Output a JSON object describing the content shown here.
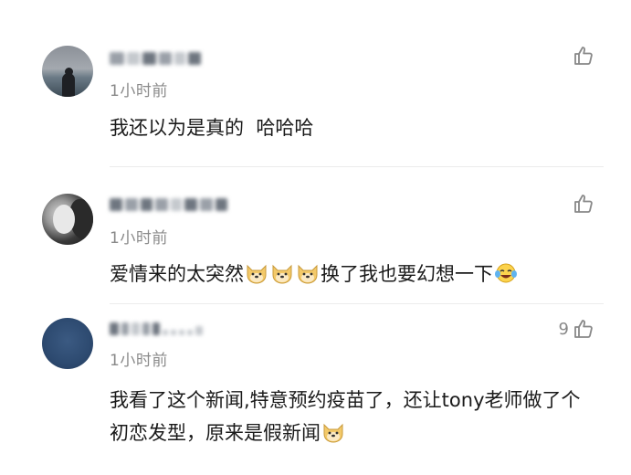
{
  "comments": [
    {
      "avatar": "landscape-avatar",
      "username": "",
      "time": "1小时前",
      "text": "我还以为是真的  哈哈哈",
      "like_count": "",
      "like_icon": "thumbs-up-icon"
    },
    {
      "avatar": "portrait-avatar",
      "username": "",
      "time": "1小时前",
      "text_before": "爱情来的太突然",
      "emoji_1": "doge-emoji",
      "text_after": "换了我也要幻想一下",
      "emoji_2": "laugh-cry-emoji",
      "like_count": "",
      "like_icon": "thumbs-up-icon"
    },
    {
      "avatar": "blue-avatar",
      "username": "",
      "time": "1小时前",
      "text": "我看了这个新闻,特意预约疫苗了，还让tony老师做了个初恋发型，原来是假新闻",
      "emoji": "doge-emoji",
      "like_count": "9",
      "like_icon": "thumbs-up-icon"
    }
  ],
  "colors": {
    "time": "#8a8a8a",
    "text": "#1a1a1a",
    "like": "#888888"
  }
}
